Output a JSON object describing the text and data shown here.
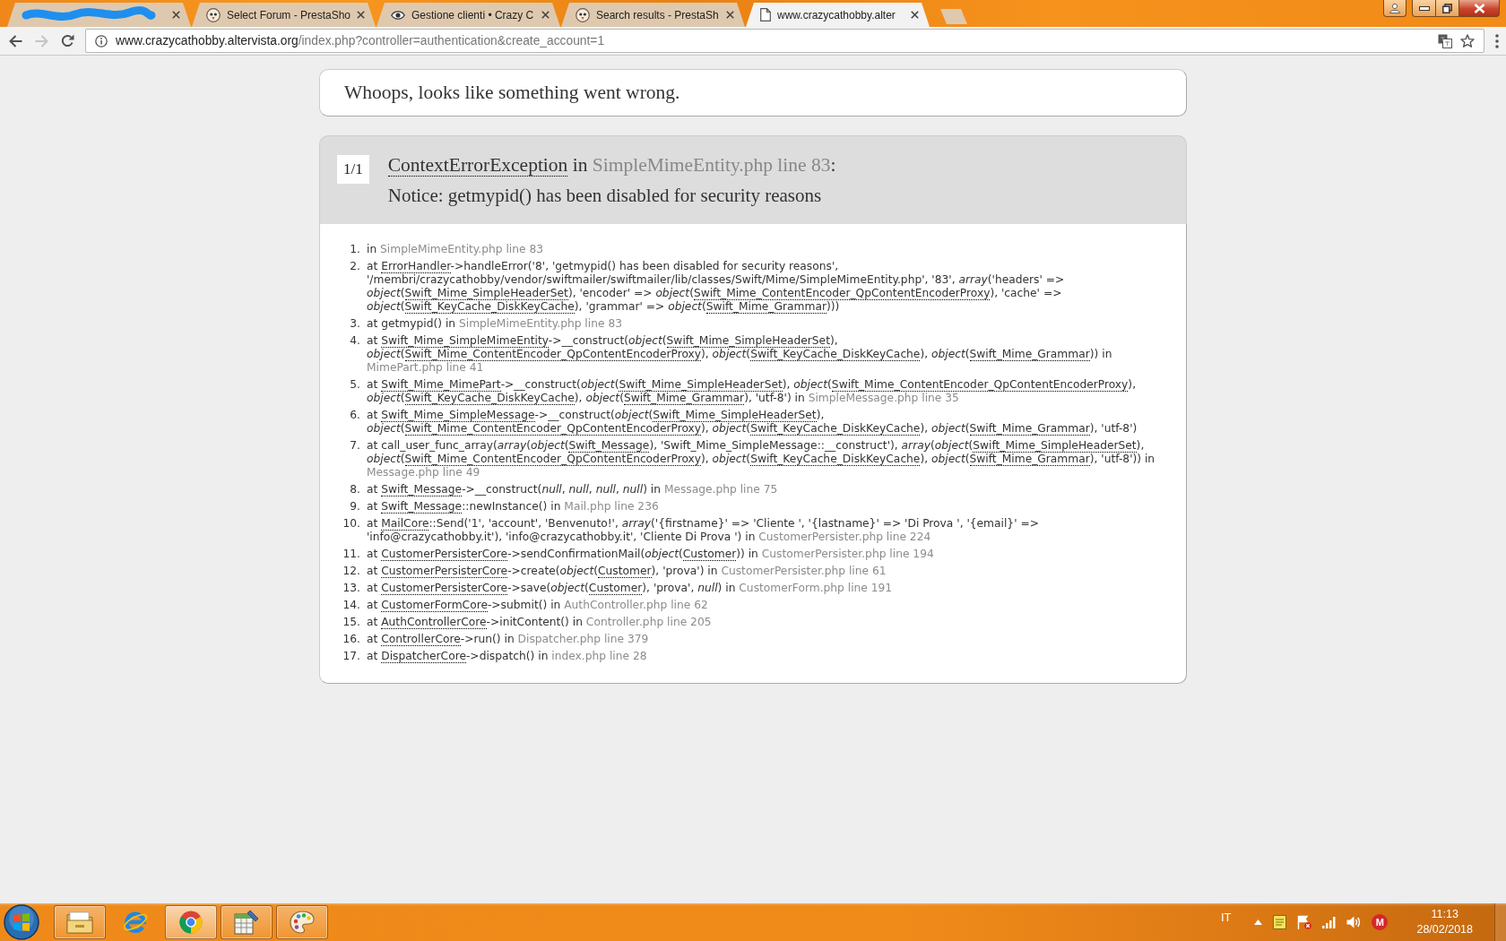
{
  "browser": {
    "tabs": [
      {
        "kind": "redacted",
        "selected": false
      },
      {
        "kind": "bird",
        "title": "Select Forum - PrestaSho",
        "selected": false
      },
      {
        "kind": "eye",
        "title": "Gestione clienti • Crazy C",
        "selected": false
      },
      {
        "kind": "bird",
        "title": "Search results - PrestaSh",
        "selected": false
      },
      {
        "kind": "document",
        "title": "www.crazycathobby.alter",
        "selected": true
      }
    ],
    "nav": [
      {
        "kind": "back",
        "disabled": false
      },
      {
        "kind": "forward",
        "disabled": true
      },
      {
        "kind": "reload",
        "disabled": false
      }
    ],
    "address": {
      "host": "www.crazycathobby.altervista.org",
      "path": "/index.php?controller=authentication&create_account=1"
    }
  },
  "page": {
    "heading": "Whoops, looks like something went wrong.",
    "exception": {
      "counter": "1/1",
      "title": [
        {
          "kind": "class",
          "text": "ContextErrorException"
        },
        {
          "kind": "text",
          "text": " in "
        },
        {
          "kind": "file",
          "text": "SimpleMimeEntity.php line 83"
        },
        {
          "kind": "text",
          "text": ":"
        }
      ],
      "message": "Notice: getmypid() has been disabled for security reasons"
    },
    "trace": [
      {
        "number": "1.",
        "parts": [
          {
            "kind": "text",
            "text": "in "
          },
          {
            "kind": "file",
            "text": "SimpleMimeEntity.php line 83"
          }
        ]
      },
      {
        "number": "2.",
        "parts": [
          {
            "kind": "text",
            "text": "at "
          },
          {
            "kind": "class",
            "text": "ErrorHandler"
          },
          {
            "kind": "text",
            "text": "->handleError('8', 'getmypid() has been disabled for security reasons', '/membri/crazycathobby/vendor/swiftmailer/swiftmailer/lib/classes/Swift/Mime/SimpleMimeEntity.php', '83', *array*('headers' => *object*("
          },
          {
            "kind": "class",
            "text": "Swift_Mime_SimpleHeaderSet"
          },
          {
            "kind": "text",
            "text": "), 'encoder' => *object*("
          },
          {
            "kind": "class",
            "text": "Swift_Mime_ContentEncoder_QpContentEncoderProxy"
          },
          {
            "kind": "text",
            "text": "), 'cache' => *object*("
          },
          {
            "kind": "class",
            "text": "Swift_KeyCache_DiskKeyCache"
          },
          {
            "kind": "text",
            "text": "), 'grammar' => *object*("
          },
          {
            "kind": "class",
            "text": "Swift_Mime_Grammar"
          },
          {
            "kind": "text",
            "text": ")))"
          }
        ]
      },
      {
        "number": "3.",
        "parts": [
          {
            "kind": "text",
            "text": "at getmypid() in "
          },
          {
            "kind": "file",
            "text": "SimpleMimeEntity.php line 83"
          }
        ]
      },
      {
        "number": "4.",
        "parts": [
          {
            "kind": "text",
            "text": "at "
          },
          {
            "kind": "class",
            "text": "Swift_Mime_SimpleMimeEntity"
          },
          {
            "kind": "text",
            "text": "->__construct(*object*("
          },
          {
            "kind": "class",
            "text": "Swift_Mime_SimpleHeaderSet"
          },
          {
            "kind": "text",
            "text": "), *object*("
          },
          {
            "kind": "class",
            "text": "Swift_Mime_ContentEncoder_QpContentEncoderProxy"
          },
          {
            "kind": "text",
            "text": "), *object*("
          },
          {
            "kind": "class",
            "text": "Swift_KeyCache_DiskKeyCache"
          },
          {
            "kind": "text",
            "text": "), *object*("
          },
          {
            "kind": "class",
            "text": "Swift_Mime_Grammar"
          },
          {
            "kind": "text",
            "text": ")) in "
          },
          {
            "kind": "file",
            "text": "MimePart.php line 41"
          }
        ]
      },
      {
        "number": "5.",
        "parts": [
          {
            "kind": "text",
            "text": "at "
          },
          {
            "kind": "class",
            "text": "Swift_Mime_MimePart"
          },
          {
            "kind": "text",
            "text": "->__construct(*object*("
          },
          {
            "kind": "class",
            "text": "Swift_Mime_SimpleHeaderSet"
          },
          {
            "kind": "text",
            "text": "), *object*("
          },
          {
            "kind": "class",
            "text": "Swift_Mime_ContentEncoder_QpContentEncoderProxy"
          },
          {
            "kind": "text",
            "text": "), *object*("
          },
          {
            "kind": "class",
            "text": "Swift_KeyCache_DiskKeyCache"
          },
          {
            "kind": "text",
            "text": "), *object*("
          },
          {
            "kind": "class",
            "text": "Swift_Mime_Grammar"
          },
          {
            "kind": "text",
            "text": "), 'utf-8') in "
          },
          {
            "kind": "file",
            "text": "SimpleMessage.php line 35"
          }
        ]
      },
      {
        "number": "6.",
        "parts": [
          {
            "kind": "text",
            "text": "at "
          },
          {
            "kind": "class",
            "text": "Swift_Mime_SimpleMessage"
          },
          {
            "kind": "text",
            "text": "->__construct(*object*("
          },
          {
            "kind": "class",
            "text": "Swift_Mime_SimpleHeaderSet"
          },
          {
            "kind": "text",
            "text": "), *object*("
          },
          {
            "kind": "class",
            "text": "Swift_Mime_ContentEncoder_QpContentEncoderProxy"
          },
          {
            "kind": "text",
            "text": "), *object*("
          },
          {
            "kind": "class",
            "text": "Swift_KeyCache_DiskKeyCache"
          },
          {
            "kind": "text",
            "text": "), *object*("
          },
          {
            "kind": "class",
            "text": "Swift_Mime_Grammar"
          },
          {
            "kind": "text",
            "text": "), 'utf-8')"
          }
        ]
      },
      {
        "number": "7.",
        "parts": [
          {
            "kind": "text",
            "text": "at call_user_func_array(*array*(*object*("
          },
          {
            "kind": "class",
            "text": "Swift_Message"
          },
          {
            "kind": "text",
            "text": "), 'Swift_Mime_SimpleMessage::__construct'), *array*(*object*("
          },
          {
            "kind": "class",
            "text": "Swift_Mime_SimpleHeaderSet"
          },
          {
            "kind": "text",
            "text": "), *object*("
          },
          {
            "kind": "class",
            "text": "Swift_Mime_ContentEncoder_QpContentEncoderProxy"
          },
          {
            "kind": "text",
            "text": "), *object*("
          },
          {
            "kind": "class",
            "text": "Swift_KeyCache_DiskKeyCache"
          },
          {
            "kind": "text",
            "text": "), *object*("
          },
          {
            "kind": "class",
            "text": "Swift_Mime_Grammar"
          },
          {
            "kind": "text",
            "text": "), 'utf-8')) in "
          },
          {
            "kind": "file",
            "text": "Message.php line 49"
          }
        ]
      },
      {
        "number": "8.",
        "parts": [
          {
            "kind": "text",
            "text": "at "
          },
          {
            "kind": "class",
            "text": "Swift_Message"
          },
          {
            "kind": "text",
            "text": "->__construct(*null*, *null*, *null*, *null*) in "
          },
          {
            "kind": "file",
            "text": "Message.php line 75"
          }
        ]
      },
      {
        "number": "9.",
        "parts": [
          {
            "kind": "text",
            "text": "at "
          },
          {
            "kind": "class",
            "text": "Swift_Message"
          },
          {
            "kind": "text",
            "text": "::newInstance() in "
          },
          {
            "kind": "file",
            "text": "Mail.php line 236"
          }
        ]
      },
      {
        "number": "10.",
        "parts": [
          {
            "kind": "text",
            "text": "at "
          },
          {
            "kind": "class",
            "text": "MailCore"
          },
          {
            "kind": "text",
            "text": "::Send('1', 'account', 'Benvenuto!', *array*('{firstname}' => 'Cliente ', '{lastname}' => 'Di Prova ', '{email}' => 'info@crazycathobby.it'), 'info@crazycathobby.it', 'Cliente Di Prova ') in "
          },
          {
            "kind": "file",
            "text": "CustomerPersister.php line 224"
          }
        ]
      },
      {
        "number": "11.",
        "parts": [
          {
            "kind": "text",
            "text": "at "
          },
          {
            "kind": "class",
            "text": "CustomerPersisterCore"
          },
          {
            "kind": "text",
            "text": "->sendConfirmationMail(*object*("
          },
          {
            "kind": "class",
            "text": "Customer"
          },
          {
            "kind": "text",
            "text": ")) in "
          },
          {
            "kind": "file",
            "text": "CustomerPersister.php line 194"
          }
        ]
      },
      {
        "number": "12.",
        "parts": [
          {
            "kind": "text",
            "text": "at "
          },
          {
            "kind": "class",
            "text": "CustomerPersisterCore"
          },
          {
            "kind": "text",
            "text": "->create(*object*("
          },
          {
            "kind": "class",
            "text": "Customer"
          },
          {
            "kind": "text",
            "text": "), 'prova') in "
          },
          {
            "kind": "file",
            "text": "CustomerPersister.php line 61"
          }
        ]
      },
      {
        "number": "13.",
        "parts": [
          {
            "kind": "text",
            "text": "at "
          },
          {
            "kind": "class",
            "text": "CustomerPersisterCore"
          },
          {
            "kind": "text",
            "text": "->save(*object*("
          },
          {
            "kind": "class",
            "text": "Customer"
          },
          {
            "kind": "text",
            "text": "), 'prova', *null*) in "
          },
          {
            "kind": "file",
            "text": "CustomerForm.php line 191"
          }
        ]
      },
      {
        "number": "14.",
        "parts": [
          {
            "kind": "text",
            "text": "at "
          },
          {
            "kind": "class",
            "text": "CustomerFormCore"
          },
          {
            "kind": "text",
            "text": "->submit() in "
          },
          {
            "kind": "file",
            "text": "AuthController.php line 62"
          }
        ]
      },
      {
        "number": "15.",
        "parts": [
          {
            "kind": "text",
            "text": "at "
          },
          {
            "kind": "class",
            "text": "AuthControllerCore"
          },
          {
            "kind": "text",
            "text": "->initContent() in "
          },
          {
            "kind": "file",
            "text": "Controller.php line 205"
          }
        ]
      },
      {
        "number": "16.",
        "parts": [
          {
            "kind": "text",
            "text": "at "
          },
          {
            "kind": "class",
            "text": "ControllerCore"
          },
          {
            "kind": "text",
            "text": "->run() in "
          },
          {
            "kind": "file",
            "text": "Dispatcher.php line 379"
          }
        ]
      },
      {
        "number": "17.",
        "parts": [
          {
            "kind": "text",
            "text": "at "
          },
          {
            "kind": "class",
            "text": "DispatcherCore"
          },
          {
            "kind": "text",
            "text": "->dispatch() in "
          },
          {
            "kind": "file",
            "text": "index.php line 28"
          }
        ]
      }
    ]
  },
  "taskbar": {
    "apps": [
      {
        "kind": "folder",
        "running": true,
        "active": false
      },
      {
        "kind": "e-logo",
        "running": false,
        "active": false
      },
      {
        "kind": "round-logo",
        "running": true,
        "active": true
      },
      {
        "kind": "spreadsheet",
        "running": true,
        "active": false
      },
      {
        "kind": "palette",
        "running": true,
        "active": false
      }
    ],
    "language": "IT",
    "badge": "M",
    "time": "11:13",
    "date": "28/02/2018"
  }
}
